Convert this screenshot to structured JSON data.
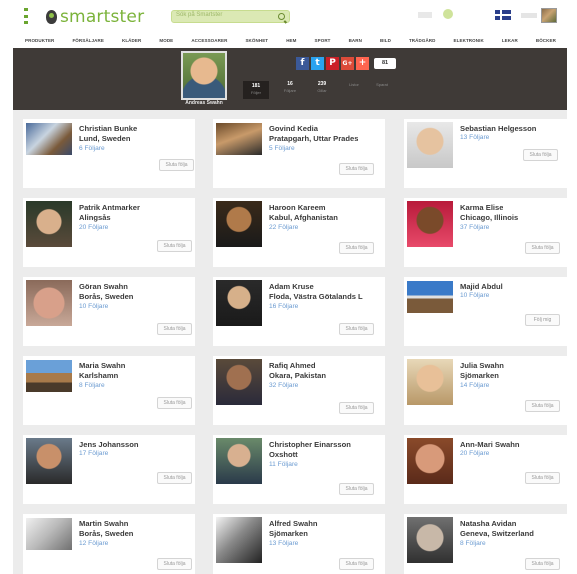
{
  "brand": {
    "name": "smartster"
  },
  "search": {
    "placeholder": "Sök på Smartster"
  },
  "categories": [
    "PRODUKTER",
    "FÖRSÄLJARE",
    "KLÄDER",
    "MODE",
    "ACCESSOARER",
    "SKÖNHET",
    "HEM",
    "SPORT",
    "BARN",
    "BILD",
    "TRÄDGÅRD",
    "ELEKTRONIK",
    "LEKAR",
    "BÖCKER"
  ],
  "profile": {
    "name": "Andreas Swahn",
    "stats": [
      {
        "value": "181",
        "label": "Följer"
      },
      {
        "value": "16",
        "label": "Följare"
      },
      {
        "value": "239",
        "label": "Gillar"
      },
      {
        "value": "",
        "label": "Listor"
      },
      {
        "value": "",
        "label": "Sparat"
      }
    ],
    "share_count": "81"
  },
  "colors": {
    "accent": "#7bb33a",
    "banner": "#3f3a37",
    "link": "#6b9bd1"
  },
  "unfollow_label": "Sluta följa",
  "follow_label": "Följ mig",
  "users": [
    {
      "name": "Christian Bunke",
      "location": "Lund, Sweden",
      "followers": "6 Följare",
      "button": "unfollow"
    },
    {
      "name": "Govind Kedia",
      "location": "Pratapgarh, Uttar Prades",
      "followers": "5 Följare",
      "button": "unfollow"
    },
    {
      "name": "Sebastian Helgesson",
      "location": "",
      "followers": "13 Följare",
      "button": "unfollow"
    },
    {
      "name": "Patrik Antmarker",
      "location": "Alingsås",
      "followers": "20 Följare",
      "button": "unfollow"
    },
    {
      "name": "Haroon Kareem",
      "location": "Kabul, Afghanistan",
      "followers": "22 Följare",
      "button": "unfollow"
    },
    {
      "name": "Karma Elise",
      "location": "Chicago, Illinois",
      "followers": "37 Följare",
      "button": "unfollow"
    },
    {
      "name": "Göran Swahn",
      "location": "Borås, Sweden",
      "followers": "10 Följare",
      "button": "unfollow"
    },
    {
      "name": "Adam Kruse",
      "location": "Floda, Västra Götalands L",
      "followers": "16 Följare",
      "button": "unfollow"
    },
    {
      "name": "Majid Abdul",
      "location": "",
      "followers": "10 Följare",
      "button": "follow"
    },
    {
      "name": "Maria Swahn",
      "location": "Karlshamn",
      "followers": "8 Följare",
      "button": "unfollow"
    },
    {
      "name": "Rafiq Ahmed",
      "location": "Okara, Pakistan",
      "followers": "32 Följare",
      "button": "unfollow"
    },
    {
      "name": "Julia Swahn",
      "location": "Sjömarken",
      "followers": "14 Följare",
      "button": "unfollow"
    },
    {
      "name": "Jens Johansson",
      "location": "",
      "followers": "17 Följare",
      "button": "unfollow"
    },
    {
      "name": "Christopher Einarsson",
      "location": "Oxshott",
      "followers": "11 Följare",
      "button": "unfollow"
    },
    {
      "name": "Ann-Mari Swahn",
      "location": "",
      "followers": "20 Följare",
      "button": "unfollow"
    },
    {
      "name": "Martin Swahn",
      "location": "Borås, Sweden",
      "followers": "12 Följare",
      "button": "unfollow"
    },
    {
      "name": "Alfred Swahn",
      "location": "Sjömarken",
      "followers": "13 Följare",
      "button": "unfollow"
    },
    {
      "name": "Natasha Avidan",
      "location": "Geneva, Switzerland",
      "followers": "8 Följare",
      "button": "unfollow"
    }
  ]
}
